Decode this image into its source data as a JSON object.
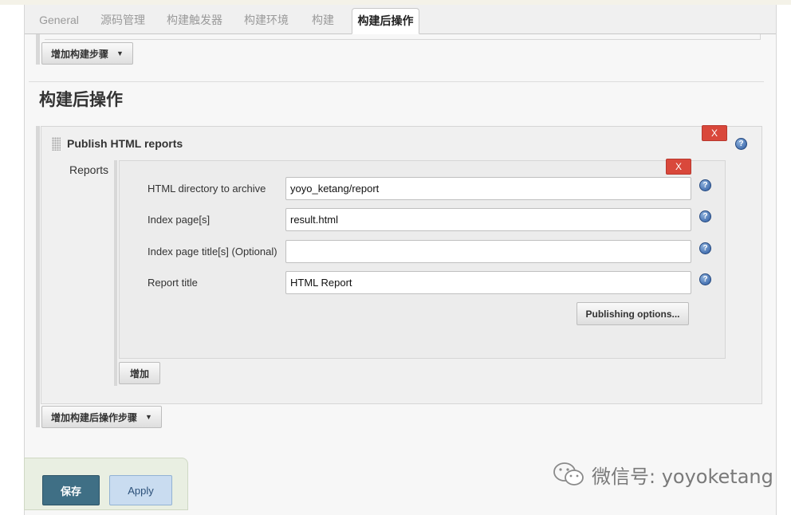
{
  "tabs": [
    {
      "label": "General",
      "active": false
    },
    {
      "label": "源码管理",
      "active": false
    },
    {
      "label": "构建触发器",
      "active": false
    },
    {
      "label": "构建环境",
      "active": false
    },
    {
      "label": "构建",
      "active": false
    },
    {
      "label": "构建后操作",
      "active": true
    }
  ],
  "build": {
    "add_step_label": "增加构建步骤"
  },
  "post_build": {
    "title": "构建后操作",
    "publisher": {
      "title": "Publish HTML reports",
      "delete_label": "X",
      "reports_label": "Reports",
      "report": {
        "delete_label": "X",
        "fields": [
          {
            "label": "HTML directory to archive",
            "value": "yoyo_ketang/report"
          },
          {
            "label": "Index page[s]",
            "value": "result.html"
          },
          {
            "label": "Index page title[s] (Optional)",
            "value": ""
          },
          {
            "label": "Report title",
            "value": "HTML Report"
          }
        ],
        "publishing_options_label": "Publishing options..."
      },
      "add_label": "增加"
    },
    "add_post_step_label": "增加构建后操作步骤"
  },
  "footer": {
    "save_label": "保存",
    "apply_label": "Apply"
  },
  "watermark": {
    "text": "微信号: yoyoketang"
  },
  "help_glyph": "?",
  "colors": {
    "delete": "#d9483b",
    "save": "#3f6f85",
    "apply": "#c9dcf0",
    "help": "#2c5aa0"
  }
}
